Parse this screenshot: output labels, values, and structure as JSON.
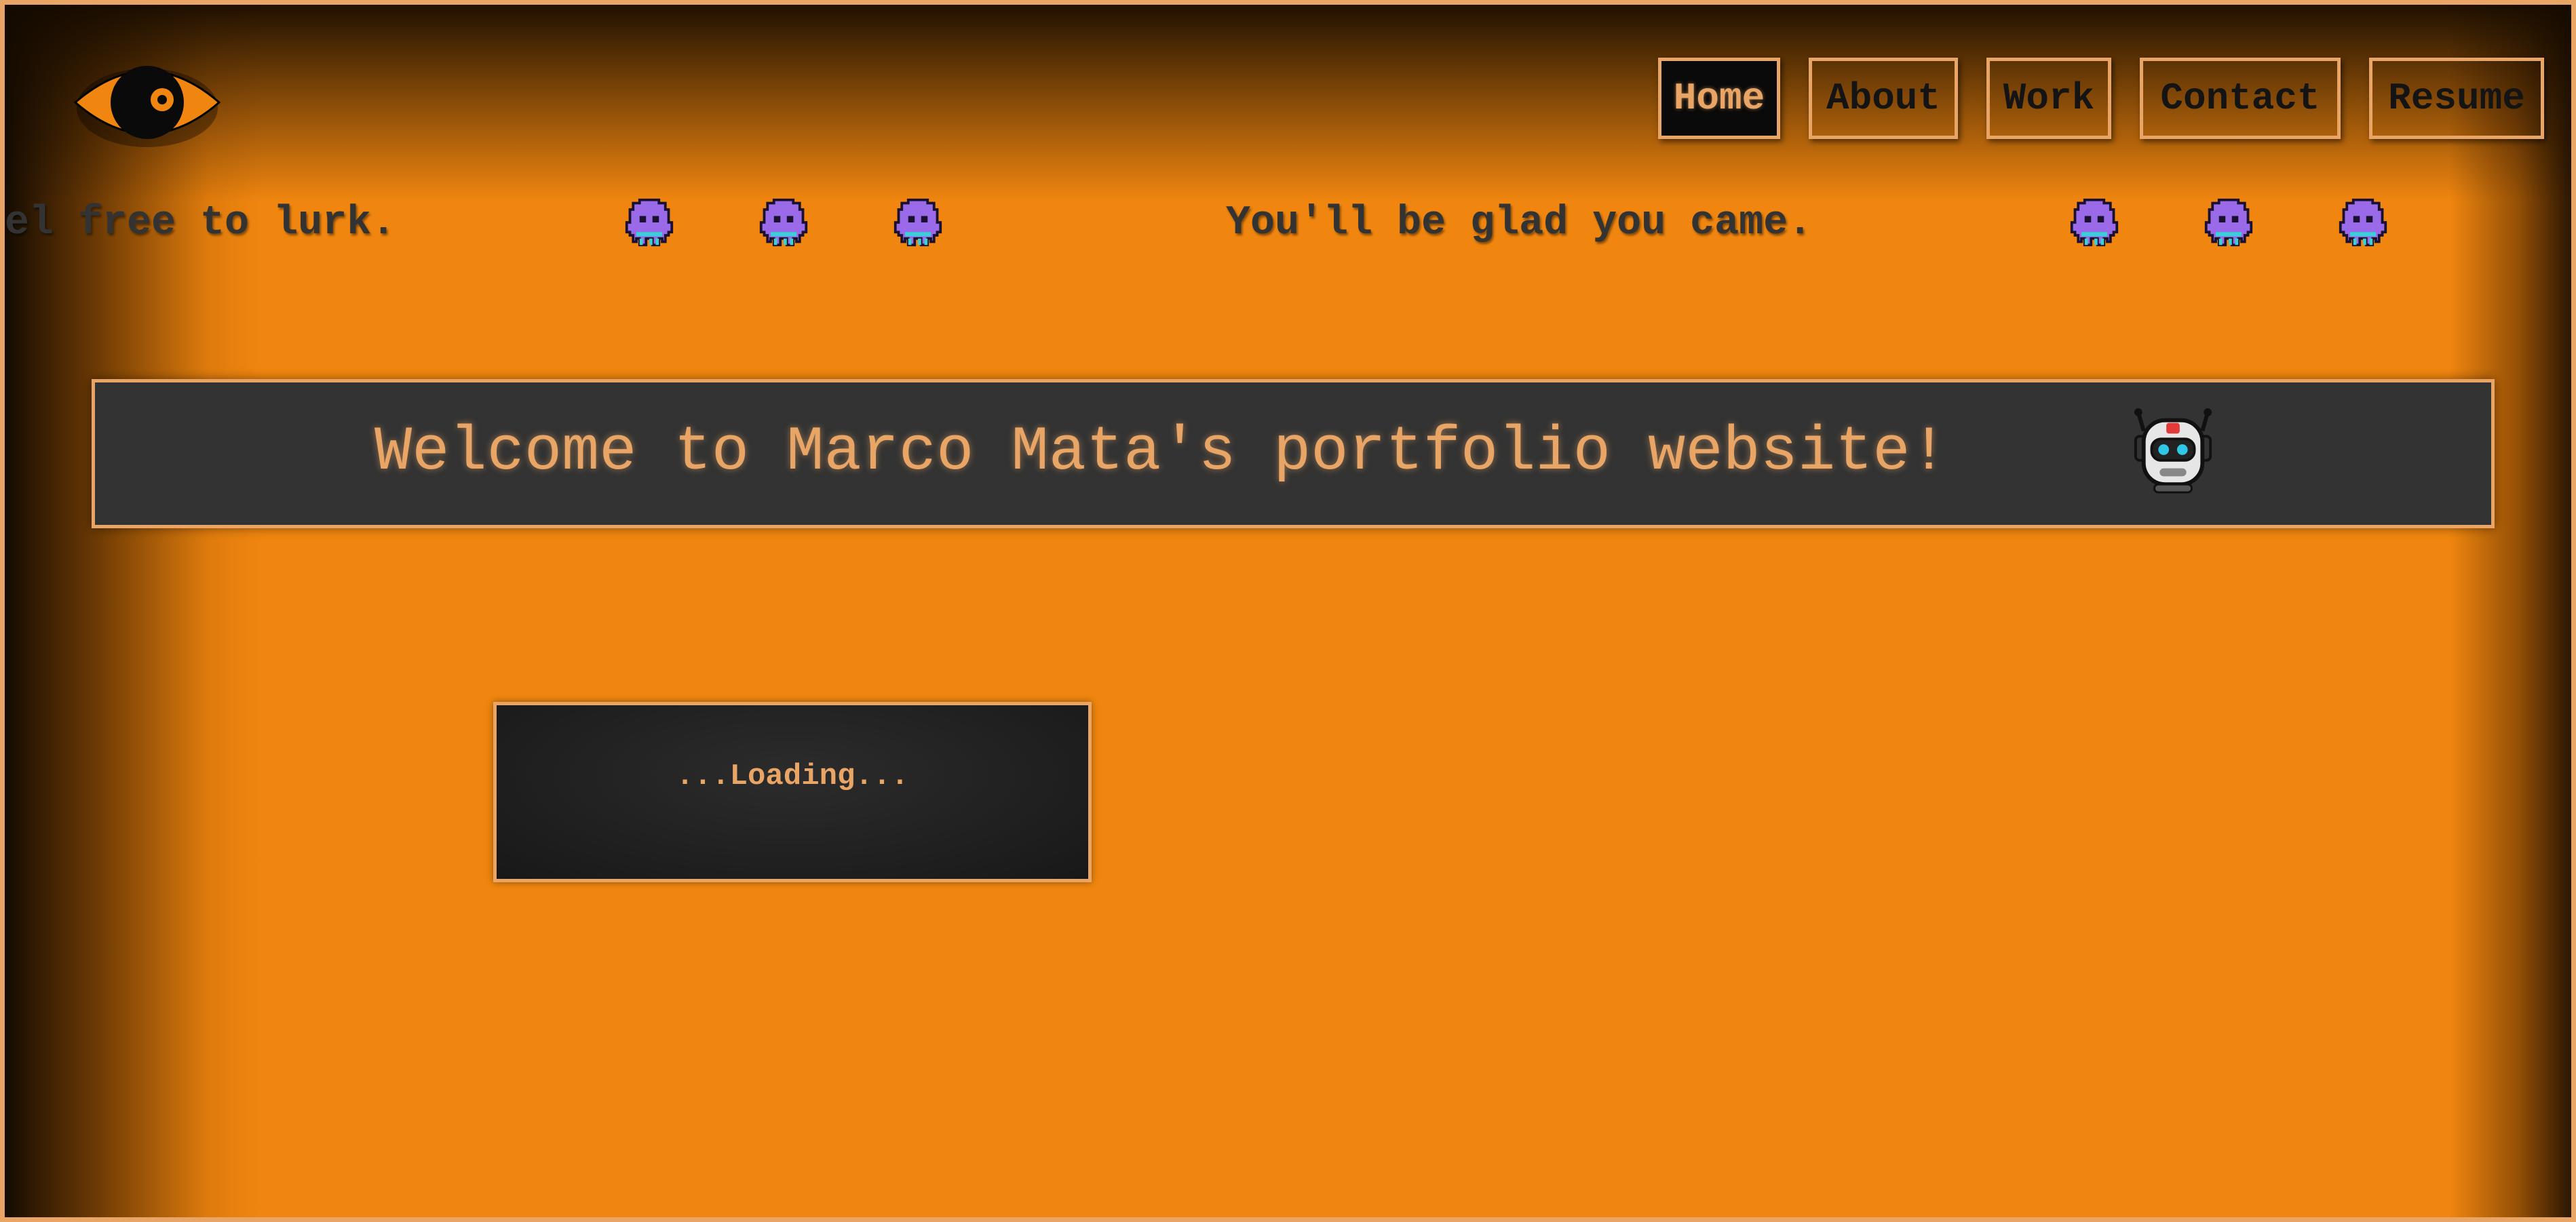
{
  "logo": {
    "icon": "eye-icon",
    "accent": "#f0860f"
  },
  "nav": {
    "home": "Home",
    "about": "About",
    "work": "Work",
    "contact": "Contact",
    "resume": "Resume",
    "active": "Home"
  },
  "marquee": {
    "text_1": "el free to lurk.",
    "text_2": "You'll be glad you came.",
    "icon": "alien-monster-icon"
  },
  "banner": {
    "title": "Welcome to Marco Mata's portfolio website!",
    "icon": "robot-icon"
  },
  "loading": {
    "text": "...Loading..."
  },
  "colors": {
    "background": "#f0860f",
    "accent": "#e8a566",
    "panel": "#333333",
    "dark_panel": "#1a1a1a"
  }
}
